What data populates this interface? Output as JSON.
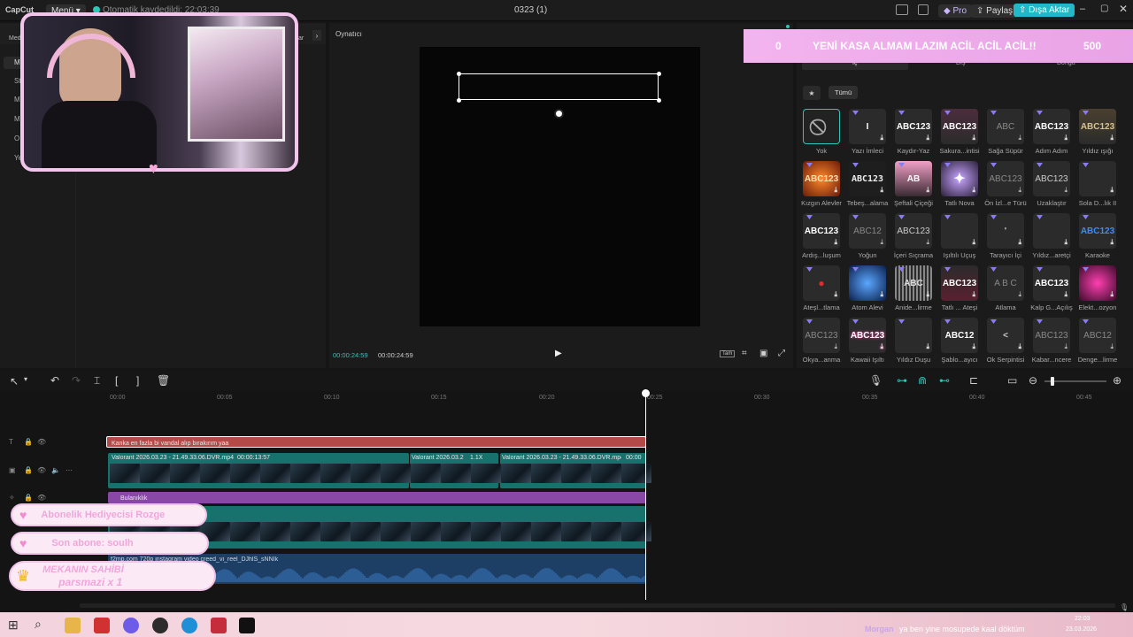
{
  "titlebar": {
    "app_name": "CapCut",
    "menu_label": "Menü",
    "autosave_text": "Otomatik kaydedildi: 22:03:39",
    "project_title": "0323 (1)",
    "pro_label": "Pro",
    "share_label": "Paylaş",
    "export_label": "Dışa Aktar"
  },
  "left_panel": {
    "media_tab": "Medya",
    "partial_tab_right": "ar",
    "side_items": [
      "M",
      "St",
      "M",
      "M",
      "O",
      "Ye"
    ]
  },
  "player": {
    "label": "Oynatıcı",
    "time_current": "00:00:24:59",
    "time_total": "00:00:24:59",
    "fullscreen_label": "Tam"
  },
  "overlay_banner": {
    "left_count": "0",
    "goal_text": "YENİ KASA ALMAM LAZIM ACİL ACİL ACİL!!",
    "right_count": "500"
  },
  "effects_panel": {
    "tabs": [
      "İç",
      "Dış",
      "Döngü"
    ],
    "filter_all": "Tümü",
    "items": [
      {
        "label": "Yok",
        "preview": "⃠",
        "style": "none"
      },
      {
        "label": "Yazı İmleci",
        "preview": "I",
        "style": "plain"
      },
      {
        "label": "Kaydır-Yaz",
        "preview": "ABC123",
        "style": "plain"
      },
      {
        "label": "Sakura...intisi",
        "preview": "ABC123",
        "style": "sakura"
      },
      {
        "label": "Sağa Süpür",
        "preview": "ABC",
        "style": "dim"
      },
      {
        "label": "Adım Adım",
        "preview": "ABC123",
        "style": "plain"
      },
      {
        "label": "Yıldız ışığı",
        "preview": "ABC123",
        "style": "gold"
      },
      {
        "label": "Kızgın Alevler",
        "preview": "ABC123",
        "style": "fire"
      },
      {
        "label": "Tebeş...alama",
        "preview": "ABC123",
        "style": "chalk"
      },
      {
        "label": "Şeftali Çiçeği",
        "preview": "AB",
        "style": "peach"
      },
      {
        "label": "Tatlı Nova",
        "preview": "✦",
        "style": "nova"
      },
      {
        "label": "Ön İzl...e Türü",
        "preview": "ABC123",
        "style": "dim"
      },
      {
        "label": "Uzaklaştır",
        "preview": "ABC123",
        "style": "thin"
      },
      {
        "label": "Sola D...lık II",
        "preview": "",
        "style": "empty"
      },
      {
        "label": "Ardış...luşum",
        "preview": "ABC123",
        "style": "plain"
      },
      {
        "label": "Yoğun",
        "preview": "ABC12",
        "style": "dim"
      },
      {
        "label": "İçeri Sıçrama",
        "preview": "ABC123",
        "style": "thin"
      },
      {
        "label": "Işıltılı Uçuş",
        "preview": "",
        "style": "empty"
      },
      {
        "label": "Tarayıcı İçi",
        "preview": "'",
        "style": "empty"
      },
      {
        "label": "Yıldız...aretçi",
        "preview": "",
        "style": "empty"
      },
      {
        "label": "Karaoke",
        "preview": "ABC123",
        "style": "karaoke"
      },
      {
        "label": "Ateşl...tlama",
        "preview": "●",
        "style": "redball"
      },
      {
        "label": "Atom Alevi",
        "preview": "",
        "style": "atom"
      },
      {
        "label": "Anide...lirme",
        "preview": "ABC",
        "style": "bars"
      },
      {
        "label": "Tatlı ... Ateşi",
        "preview": "ABC123",
        "style": "pinkfire"
      },
      {
        "label": "Atlama",
        "preview": "A B C",
        "style": "dim"
      },
      {
        "label": "Kalp G...Açılış",
        "preview": "ABC123",
        "style": "heart"
      },
      {
        "label": "Elekt...ozyon",
        "preview": "",
        "style": "electro"
      },
      {
        "label": "Okya...anma",
        "preview": "ABC123",
        "style": "dim"
      },
      {
        "label": "Kawaii Işıltı",
        "preview": "ABC123",
        "style": "kawaii"
      },
      {
        "label": "Yıldız Duşu",
        "preview": "",
        "style": "empty"
      },
      {
        "label": "Şablo...ayıcı",
        "preview": "ABC12",
        "style": "plain"
      },
      {
        "label": "Ok Serpintisi",
        "preview": "<",
        "style": "empty"
      },
      {
        "label": "Kabar...ncere",
        "preview": "ABC123",
        "style": "dim"
      },
      {
        "label": "Denge...lirme",
        "preview": "ABC12",
        "style": "dim"
      }
    ]
  },
  "timeline": {
    "ruler_ticks": [
      "00:00",
      "00:05",
      "00:10",
      "00:15",
      "00:20",
      "00:25",
      "00:30",
      "00:35",
      "00:40",
      "00:45"
    ],
    "text_clip": "Kanka en fazla bi vandal alıp bırakırım yaa",
    "video_clip_1": "Valorant 2026.03.23 - 21.49.33.06.DVR.mp4",
    "video_clip_1_duration": "00:00:13:57",
    "video_clip_2": "Valorant 2026.03.2",
    "video_clip_2_speed": "1.1X",
    "video_clip_3": "Valorant 2026.03.23 - 21.49.33.06.DVR.mp4",
    "video_clip_3_duration": "00:00",
    "effect_clip": "Bulanıklık",
    "audio_clip": "f2mp.com 720p instagram video creed_vi_reel_DJhlS_sNNIk"
  },
  "stream_overlays": {
    "gift_badge": "Abonelik Hediyecisi Rozge",
    "last_sub": "Son abone: soulh",
    "owner_title": "MEKANIN SAHİBİ",
    "owner_value": "parsmazi x 1"
  },
  "taskbar": {
    "chat_name": "Morgan",
    "chat_message": "ya ben yine mosupede kaal döktüm",
    "clock_time": "22:03",
    "clock_date": "23.03.2026"
  }
}
